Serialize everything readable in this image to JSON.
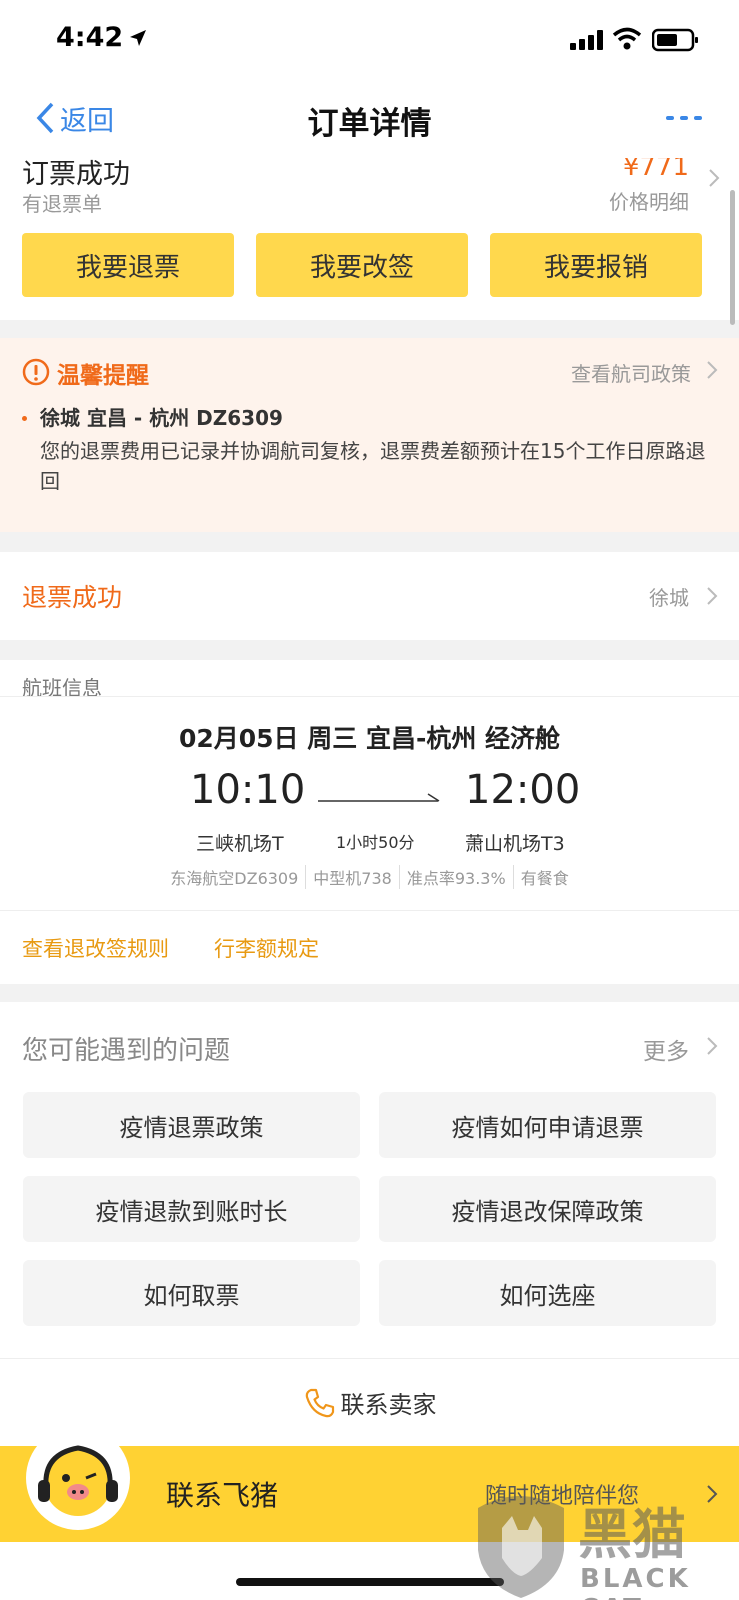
{
  "status_bar": {
    "time": "4:42"
  },
  "nav": {
    "back_label": "返回",
    "title": "订单详情"
  },
  "order": {
    "status_title": "订票成功",
    "sub_text": "有退票单",
    "price": "¥771",
    "price_detail": "价格明细",
    "buttons": [
      "我要退票",
      "我要改签",
      "我要报销"
    ]
  },
  "notice": {
    "title": "温馨提醒",
    "link": "查看航司政策",
    "flight": "徐城 宜昌 - 杭州 DZ6309",
    "text": "您的退票费用已记录并协调航司复核，退票费差额预计在15个工作日原路退回"
  },
  "refund": {
    "status": "退票成功",
    "name": "徐城"
  },
  "flight": {
    "section_label": "航班信息",
    "header": "02月05日 周三 宜昌-杭州 经济舱",
    "dep_time": "10:10",
    "arr_time": "12:00",
    "dep_airport": "三峡机场T",
    "arr_airport": "萧山机场T3",
    "duration": "1小时50分",
    "meta": [
      "东海航空DZ6309",
      "中型机738",
      "准点率93.3%",
      "有餐食"
    ]
  },
  "rules": {
    "change_rules": "查看退改签规则",
    "baggage": "行李额规定"
  },
  "faq": {
    "title": "您可能遇到的问题",
    "more": "更多",
    "items": [
      "疫情退票政策",
      "疫情如何申请退票",
      "疫情退款到账时长",
      "疫情退改保障政策",
      "如何取票",
      "如何选座"
    ]
  },
  "contact": {
    "seller": "联系卖家"
  },
  "bottom": {
    "label": "联系飞猪",
    "tagline": "随时随地陪伴您"
  },
  "watermark": {
    "text": "黑猫",
    "sub": "BLACK CAT"
  },
  "colors": {
    "accent": "#f06a1a",
    "button_yellow": "#ffd84d",
    "link_blue": "#3a87e6",
    "bar_yellow": "#ffd233"
  }
}
